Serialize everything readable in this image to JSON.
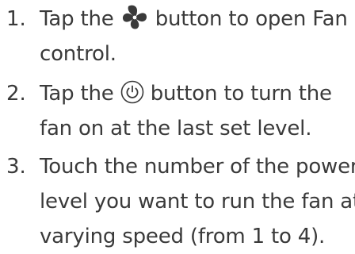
{
  "steps": [
    {
      "number": "1.",
      "icon": "fan-icon",
      "line1_before": "Tap the",
      "line1_after": "button to open Fan",
      "line2": "control."
    },
    {
      "number": "2.",
      "icon": "power-icon",
      "line1_before": "Tap the",
      "line1_after": "button to turn the",
      "line2": "fan on at the last set level."
    },
    {
      "number": "3.",
      "line1": "Touch the number of the power",
      "line2": "level you want to run the fan at",
      "line3": "varying speed (from 1 to 4)."
    }
  ],
  "colors": {
    "text": "#3a3a3a",
    "icon": "#3a3a3a"
  }
}
